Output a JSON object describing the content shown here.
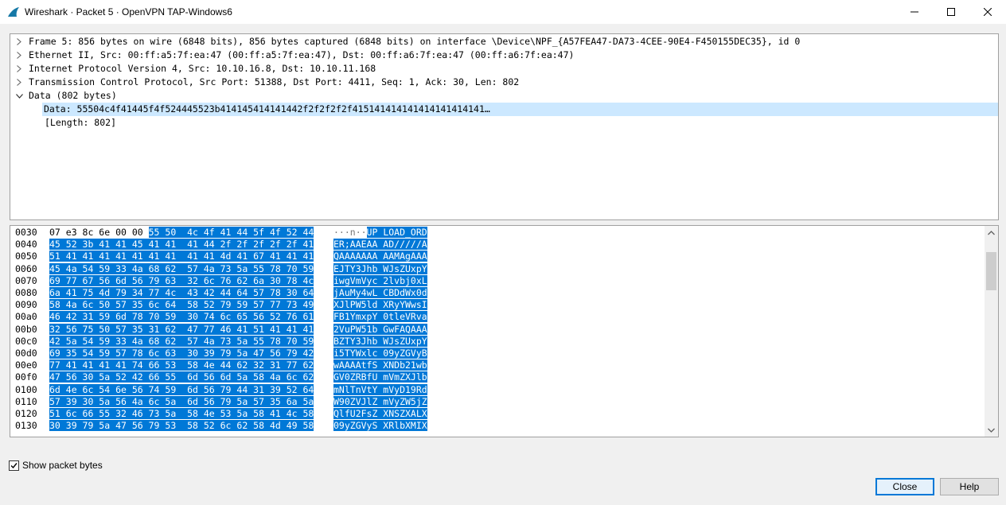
{
  "window": {
    "title": "Wireshark · Packet 5 · OpenVPN TAP-Windows6",
    "minimize_label": "—",
    "maximize_label": "☐",
    "close_label": "✕"
  },
  "tree": [
    {
      "text": "Frame 5: 856 bytes on wire (6848 bits), 856 bytes captured (6848 bits) on interface \\Device\\NPF_{A57FEA47-DA73-4CEE-90E4-F450155DEC35}, id 0",
      "expanded": false,
      "indent": 0
    },
    {
      "text": "Ethernet II, Src: 00:ff:a5:7f:ea:47 (00:ff:a5:7f:ea:47), Dst: 00:ff:a6:7f:ea:47 (00:ff:a6:7f:ea:47)",
      "expanded": false,
      "indent": 0
    },
    {
      "text": "Internet Protocol Version 4, Src: 10.10.16.8, Dst: 10.10.11.168",
      "expanded": false,
      "indent": 0
    },
    {
      "text": "Transmission Control Protocol, Src Port: 51388, Dst Port: 4411, Seq: 1, Ack: 30, Len: 802",
      "expanded": false,
      "indent": 0
    },
    {
      "text": "Data (802 bytes)",
      "expanded": true,
      "indent": 0
    },
    {
      "text": "Data: 55504c4f41445f4f524445523b414145414141442f2f2f2f2f415141414141414141414141…",
      "leaf": true,
      "indent": 1,
      "selected": true
    },
    {
      "text": "[Length: 802]",
      "leaf": true,
      "indent": 1
    }
  ],
  "bytes": [
    {
      "offset": "0030",
      "pre_hex": "07 e3 8c 6e 00 00 ",
      "hex": "55 50  4c 4f 41 44 5f 4f 52 44",
      "pre_ascii": "···n··",
      "ascii": "UP LOAD_ORD"
    },
    {
      "offset": "0040",
      "pre_hex": "",
      "hex": "45 52 3b 41 41 45 41 41  41 44 2f 2f 2f 2f 2f 41",
      "pre_ascii": "",
      "ascii": "ER;AAEAA AD/////A"
    },
    {
      "offset": "0050",
      "pre_hex": "",
      "hex": "51 41 41 41 41 41 41 41  41 41 4d 41 67 41 41 41",
      "pre_ascii": "",
      "ascii": "QAAAAAAA AAMAgAAA"
    },
    {
      "offset": "0060",
      "pre_hex": "",
      "hex": "45 4a 54 59 33 4a 68 62  57 4a 73 5a 55 78 70 59",
      "pre_ascii": "",
      "ascii": "EJTY3Jhb WJsZUxpY"
    },
    {
      "offset": "0070",
      "pre_hex": "",
      "hex": "69 77 67 56 6d 56 79 63  32 6c 76 62 6a 30 78 4c",
      "pre_ascii": "",
      "ascii": "iwgVmVyc 2lvbj0xL"
    },
    {
      "offset": "0080",
      "pre_hex": "",
      "hex": "6a 41 75 4d 79 34 77 4c  43 42 44 64 57 78 30 64",
      "pre_ascii": "",
      "ascii": "jAuMy4wL CBDdWx0d"
    },
    {
      "offset": "0090",
      "pre_hex": "",
      "hex": "58 4a 6c 50 57 35 6c 64  58 52 79 59 57 77 73 49",
      "pre_ascii": "",
      "ascii": "XJlPW5ld XRyYWwsI"
    },
    {
      "offset": "00a0",
      "pre_hex": "",
      "hex": "46 42 31 59 6d 78 70 59  30 74 6c 65 56 52 76 61",
      "pre_ascii": "",
      "ascii": "FB1YmxpY 0tleVRva"
    },
    {
      "offset": "00b0",
      "pre_hex": "",
      "hex": "32 56 75 50 57 35 31 62  47 77 46 41 51 41 41 41",
      "pre_ascii": "",
      "ascii": "2VuPW51b GwFAQAAA"
    },
    {
      "offset": "00c0",
      "pre_hex": "",
      "hex": "42 5a 54 59 33 4a 68 62  57 4a 73 5a 55 78 70 59",
      "pre_ascii": "",
      "ascii": "BZTY3Jhb WJsZUxpY"
    },
    {
      "offset": "00d0",
      "pre_hex": "",
      "hex": "69 35 54 59 57 78 6c 63  30 39 79 5a 47 56 79 42",
      "pre_ascii": "",
      "ascii": "i5TYWxlc 09yZGVyB"
    },
    {
      "offset": "00e0",
      "pre_hex": "",
      "hex": "77 41 41 41 41 74 66 53  58 4e 44 62 32 31 77 62",
      "pre_ascii": "",
      "ascii": "wAAAAtfS XNDb21wb"
    },
    {
      "offset": "00f0",
      "pre_hex": "",
      "hex": "47 56 30 5a 52 42 66 55  6d 56 6d 5a 58 4a 6c 62",
      "pre_ascii": "",
      "ascii": "GV0ZRBfU mVmZXJlb"
    },
    {
      "offset": "0100",
      "pre_hex": "",
      "hex": "6d 4e 6c 54 6e 56 74 59  6d 56 79 44 31 39 52 64",
      "pre_ascii": "",
      "ascii": "mNlTnVtY mVyD19Rd"
    },
    {
      "offset": "0110",
      "pre_hex": "",
      "hex": "57 39 30 5a 56 4a 6c 5a  6d 56 79 5a 57 35 6a 5a",
      "pre_ascii": "",
      "ascii": "W90ZVJlZ mVyZW5jZ"
    },
    {
      "offset": "0120",
      "pre_hex": "",
      "hex": "51 6c 66 55 32 46 73 5a  58 4e 53 5a 58 41 4c 58",
      "pre_ascii": "",
      "ascii": "QlfU2FsZ XNSZXALX"
    },
    {
      "offset": "0130",
      "pre_hex": "",
      "hex": "30 39 79 5a 47 56 79 53  58 52 6c 62 58 4d 49 58",
      "pre_ascii": "",
      "ascii": "09yZGVyS XRlbXMIX"
    }
  ],
  "footer": {
    "show_bytes_label": "Show packet bytes",
    "show_bytes_checked": true,
    "close_label": "Close",
    "help_label": "Help"
  },
  "colors": {
    "selection": "#0078d7",
    "tree_selection": "#cce8ff",
    "default_button_border": "#0078d7"
  }
}
